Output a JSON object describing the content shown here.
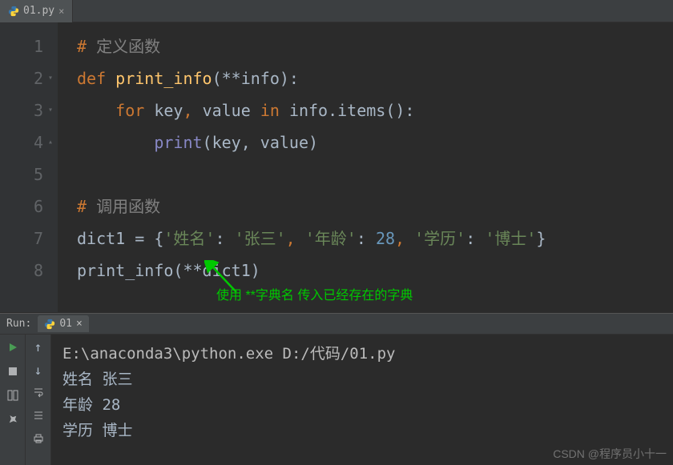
{
  "tab": {
    "filename": "01.py"
  },
  "gutter": {
    "lines": [
      "1",
      "2",
      "3",
      "4",
      "5",
      "6",
      "7",
      "8"
    ]
  },
  "code": {
    "l1": {
      "hash": "# ",
      "comment": "定义函数"
    },
    "l2": {
      "def": "def ",
      "fname": "print_info",
      "params": "(**info):"
    },
    "l3": {
      "for": "for ",
      "key": "key",
      "comma": ", ",
      "value": "value ",
      "in": "in ",
      "info": "info.items():"
    },
    "l4": {
      "print": "print",
      "args": "(key, value)"
    },
    "l6": {
      "hash": "# ",
      "comment": "调用函数"
    },
    "l7": {
      "var": "dict1 ",
      "eq": "= ",
      "open": "{",
      "k1": "'姓名'",
      "c1": ": ",
      "v1": "'张三'",
      "s1": ", ",
      "k2": "'年龄'",
      "c2": ": ",
      "v2": "28",
      "s2": ", ",
      "k3": "'学历'",
      "c3": ": ",
      "v3": "'博士'",
      "close": "}"
    },
    "l8": {
      "fn": "print_info",
      "args": "(**dict1)"
    }
  },
  "annotation": {
    "text": "使用 **字典名 传入已经存在的字典"
  },
  "run": {
    "label": "Run:",
    "tab": "01",
    "cmd": "E:\\anaconda3\\python.exe D:/代码/01.py",
    "out1_k": "姓名",
    "out1_v": "张三",
    "out2_k": "年龄",
    "out2_v": "28",
    "out3_k": "学历",
    "out3_v": "博士"
  },
  "watermark": "CSDN @程序员小十一"
}
